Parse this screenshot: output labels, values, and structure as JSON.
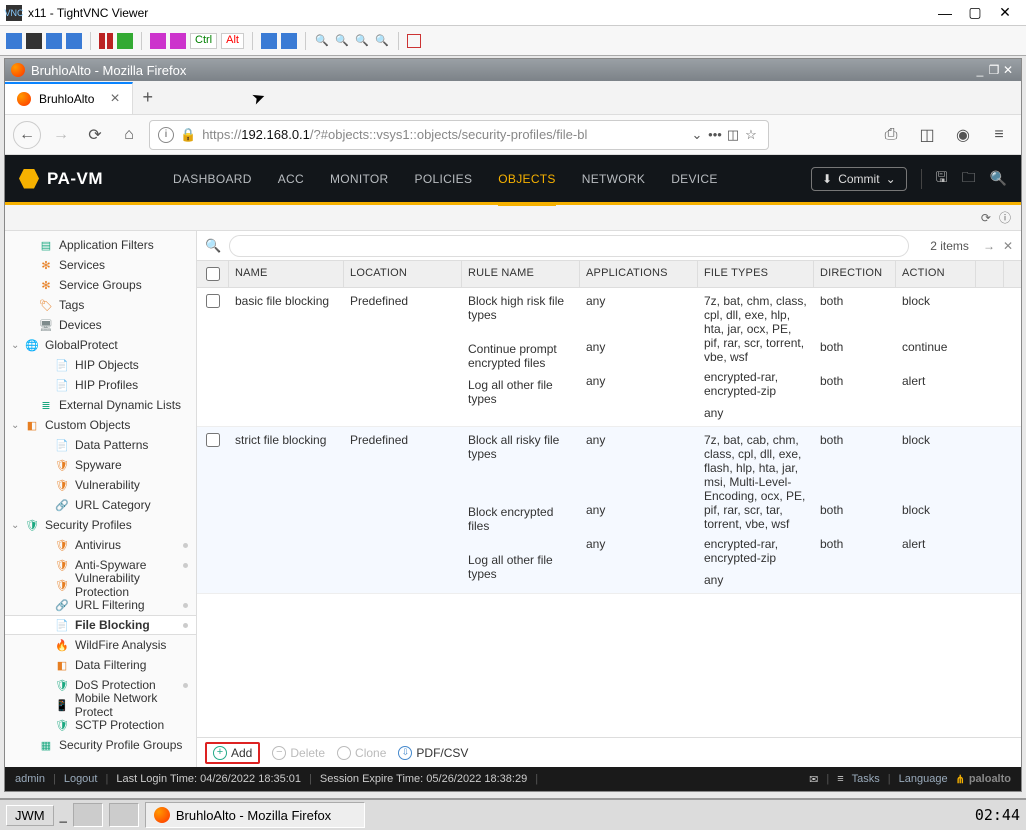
{
  "vnc": {
    "title": "x11 - TightVNC Viewer"
  },
  "vnc_tb": {
    "ctrl": "Ctrl",
    "alt": "Alt"
  },
  "firefox": {
    "win_title": "BruhloAlto - Mozilla Firefox",
    "tab_label": "BruhloAlto",
    "url_pre": "https://",
    "url_host": "192.168.0.1",
    "url_path": "/?#objects::vsys1::objects/security-profiles/file-bl"
  },
  "pa": {
    "logo": "PA-VM",
    "nav": {
      "dashboard": "DASHBOARD",
      "acc": "ACC",
      "monitor": "MONITOR",
      "policies": "POLICIES",
      "objects": "OBJECTS",
      "network": "NETWORK",
      "device": "DEVICE"
    },
    "commit": "Commit"
  },
  "sidebar": {
    "application_filters": "Application Filters",
    "services": "Services",
    "service_groups": "Service Groups",
    "tags": "Tags",
    "devices": "Devices",
    "globalprotect": "GlobalProtect",
    "hip_objects": "HIP Objects",
    "hip_profiles": "HIP Profiles",
    "external_dynamic_lists": "External Dynamic Lists",
    "custom_objects": "Custom Objects",
    "data_patterns": "Data Patterns",
    "spyware": "Spyware",
    "vulnerability": "Vulnerability",
    "url_category": "URL Category",
    "security_profiles": "Security Profiles",
    "antivirus": "Antivirus",
    "anti_spyware": "Anti-Spyware",
    "vulnerability_protection": "Vulnerability Protection",
    "url_filtering": "URL Filtering",
    "file_blocking": "File Blocking",
    "wildfire_analysis": "WildFire Analysis",
    "data_filtering": "Data Filtering",
    "dos_protection": "DoS Protection",
    "mobile_network_protect": "Mobile Network Protect",
    "sctp_protection": "SCTP Protection",
    "security_profile_groups": "Security Profile Groups"
  },
  "grid": {
    "items_count": "2 items",
    "columns": {
      "name": "NAME",
      "location": "LOCATION",
      "rule_name": "RULE NAME",
      "applications": "APPLICATIONS",
      "file_types": "FILE TYPES",
      "direction": "DIRECTION",
      "action": "ACTION"
    },
    "rows": [
      {
        "name": "basic file blocking",
        "location": "Predefined",
        "rules": [
          {
            "rule": "Block high risk file types",
            "apps": "any",
            "types": "7z, bat, chm, class, cpl, dll, exe, hlp, hta, jar, ocx, PE, pif, rar, scr, torrent, vbe, wsf",
            "dir": "both",
            "action": "block"
          },
          {
            "rule": "Continue prompt encrypted files",
            "apps": "any",
            "types": "encrypted-rar, encrypted-zip",
            "dir": "both",
            "action": "continue"
          },
          {
            "rule": "Log all other file types",
            "apps": "any",
            "types": "any",
            "dir": "both",
            "action": "alert"
          }
        ]
      },
      {
        "name": "strict file blocking",
        "location": "Predefined",
        "rules": [
          {
            "rule": "Block all risky file types",
            "apps": "any",
            "types": "7z, bat, cab, chm, class, cpl, dll, exe, flash, hlp, hta, jar, msi, Multi-Level-Encoding, ocx, PE, pif, rar, scr, tar, torrent, vbe, wsf",
            "dir": "both",
            "action": "block"
          },
          {
            "rule": "Block encrypted files",
            "apps": "any",
            "types": "encrypted-rar, encrypted-zip",
            "dir": "both",
            "action": "block"
          },
          {
            "rule": "Log all other file types",
            "apps": "any",
            "types": "any",
            "dir": "both",
            "action": "alert"
          }
        ]
      }
    ],
    "footer": {
      "add": "Add",
      "delete": "Delete",
      "clone": "Clone",
      "pdfcsv": "PDF/CSV"
    }
  },
  "status": {
    "user": "admin",
    "logout": "Logout",
    "last_login": "Last Login Time: 04/26/2022 18:35:01",
    "expire": "Session Expire Time: 05/26/2022 18:38:29",
    "tasks": "Tasks",
    "language": "Language",
    "brand": "paloalto"
  },
  "taskbar": {
    "start": "JWM",
    "task": "BruhloAlto - Mozilla Firefox",
    "clock": "02:44"
  }
}
